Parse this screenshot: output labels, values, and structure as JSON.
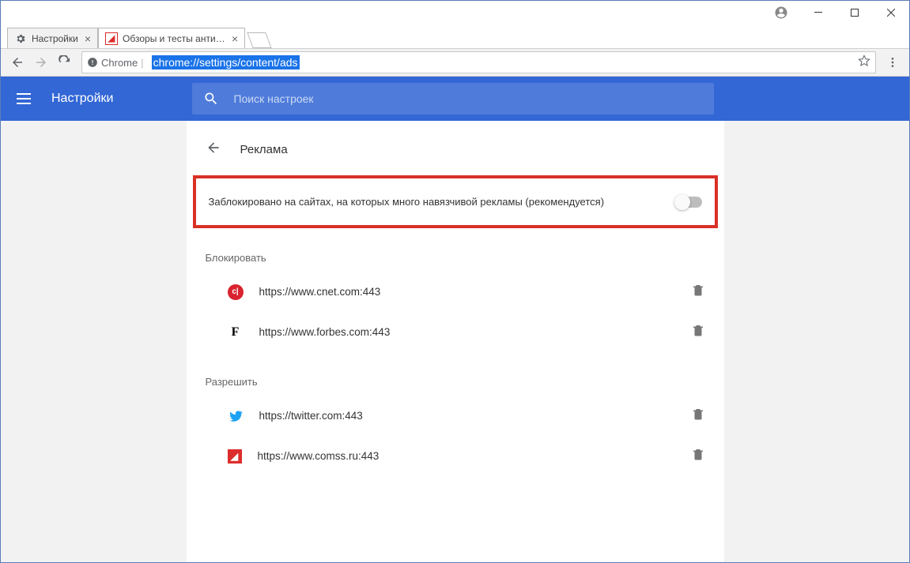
{
  "window": {
    "tabs": [
      {
        "title": "Настройки",
        "active": true
      },
      {
        "title": "Обзоры и тесты антиви",
        "active": false
      }
    ],
    "omnibox_prefix": "Chrome",
    "omnibox_url": "chrome://settings/content/ads"
  },
  "header": {
    "title": "Настройки",
    "search_placeholder": "Поиск настроек"
  },
  "page": {
    "title": "Реклама",
    "toggle_label": "Заблокировано на сайтах, на которых много навязчивой рекламы (рекомендуется)",
    "sections": {
      "block": {
        "title": "Блокировать",
        "items": [
          {
            "icon": "cnet",
            "icon_text": "c|",
            "url": "https://www.cnet.com:443"
          },
          {
            "icon": "forbes",
            "icon_text": "F",
            "url": "https://www.forbes.com:443"
          }
        ]
      },
      "allow": {
        "title": "Разрешить",
        "items": [
          {
            "icon": "twitter",
            "url": "https://twitter.com:443"
          },
          {
            "icon": "comss",
            "icon_text": "◢",
            "url": "https://www.comss.ru:443"
          }
        ]
      }
    }
  }
}
